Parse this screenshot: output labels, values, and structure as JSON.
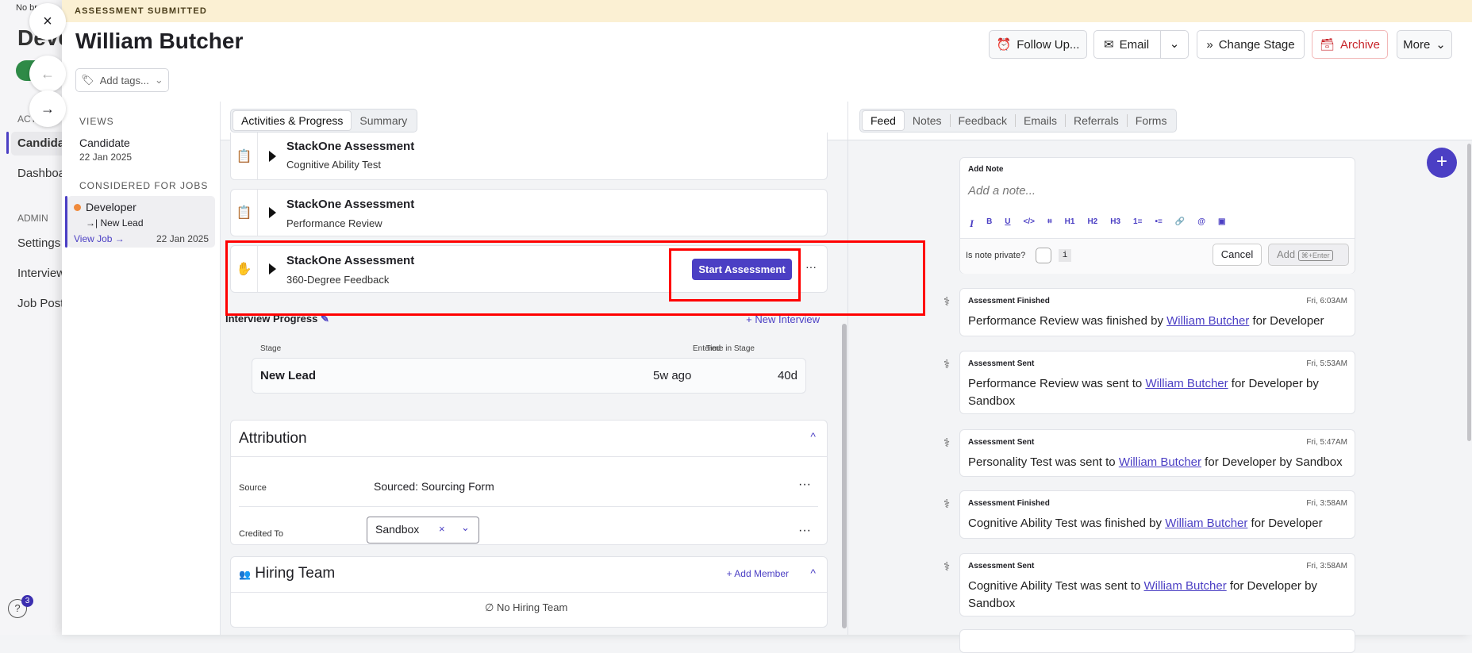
{
  "background": {
    "history": "No brow",
    "page_title": "Deve",
    "section_active": "ACT",
    "nav": [
      "Candidat",
      "Dashboa"
    ],
    "admin": "ADMIN",
    "admin_nav": [
      "Settings",
      "Interview",
      "Job Postin"
    ],
    "help_badge": "3"
  },
  "banner": "ASSESSMENT SUBMITTED",
  "candidate_name": "William Butcher",
  "tags_placeholder": "Add tags...",
  "actions": {
    "follow_up": "Follow Up...",
    "email": "Email",
    "change_stage": "Change Stage",
    "archive": "Archive",
    "more": "More"
  },
  "left": {
    "views_label": "VIEWS",
    "view_name": "Candidate",
    "view_date": "22 Jan 2025",
    "considered_label": "CONSIDERED FOR JOBS",
    "job": {
      "title": "Developer",
      "stage": "New Lead",
      "link": "View Job →",
      "date": "22 Jan 2025",
      "dot_color": "#f08a3c"
    }
  },
  "mid": {
    "tabs": [
      "Activities & Progress",
      "Summary"
    ],
    "assessments": [
      {
        "title": "StackOne Assessment",
        "sub": "Cognitive Ability Test",
        "status": "completed"
      },
      {
        "title": "StackOne Assessment",
        "sub": "Performance Review",
        "status": "completed"
      },
      {
        "title": "StackOne Assessment",
        "sub": "360-Degree Feedback",
        "status": "pending",
        "button": "Start Assessment"
      }
    ],
    "interview_progress": "Interview Progress",
    "new_interview": "+ New Interview",
    "stage_headers": [
      "Stage",
      "Entered",
      "Time in Stage"
    ],
    "stage_row": {
      "stage": "New Lead",
      "entered": "5w ago",
      "time": "40d"
    },
    "attribution": {
      "title": "Attribution",
      "source_label": "Source",
      "source_value": "Sourced: Sourcing Form",
      "credited_label": "Credited To",
      "credited_value": "Sandbox"
    },
    "hiring": {
      "title": "Hiring Team",
      "add": "+ Add Member",
      "empty": "No Hiring Team"
    }
  },
  "right": {
    "tabs": [
      "Feed",
      "Notes",
      "Feedback",
      "Emails",
      "Referrals",
      "Forms"
    ],
    "note": {
      "label": "Add Note",
      "placeholder": "Add a note...",
      "toolbar": [
        "I",
        "B",
        "U",
        "</>",
        "⌗",
        "H1",
        "H2",
        "H3",
        "1≡",
        "•≡",
        "🔗",
        "@",
        "▣"
      ],
      "private_label": "Is note private?",
      "info": "i",
      "cancel": "Cancel",
      "add": "Add",
      "shortcut": "⌘+Enter"
    },
    "feed": [
      {
        "kind": "Assessment Finished",
        "time": "Fri, 6:03AM",
        "a": "Performance Review",
        "mid": " was finished by ",
        "person": "William Butcher",
        "tail": " for Developer"
      },
      {
        "kind": "Assessment Sent",
        "time": "Fri, 5:53AM",
        "a": "Performance Review",
        "mid": " was sent to ",
        "person": "William Butcher",
        "tail": " for Developer by Sandbox"
      },
      {
        "kind": "Assessment Sent",
        "time": "Fri, 5:47AM",
        "a": "Personality Test",
        "mid": " was sent to ",
        "person": "William Butcher",
        "tail": " for Developer by Sandbox"
      },
      {
        "kind": "Assessment Finished",
        "time": "Fri, 3:58AM",
        "a": "Cognitive Ability Test",
        "mid": " was finished by ",
        "person": "William Butcher",
        "tail": " for Developer"
      },
      {
        "kind": "Assessment Sent",
        "time": "Fri, 3:58AM",
        "a": "Cognitive Ability Test",
        "mid": " was sent to ",
        "person": "William Butcher",
        "tail": " for Developer by Sandbox"
      }
    ]
  }
}
